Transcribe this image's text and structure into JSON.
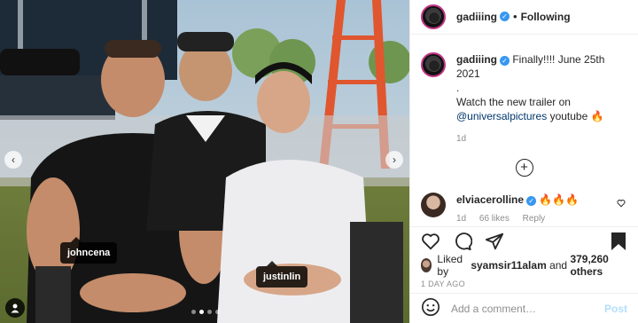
{
  "post": {
    "username": "gadiiing",
    "follow_label": "Following",
    "caption_username": "gadiiing",
    "caption_text": "Finally!!!! June 25th 2021",
    "caption_dot": ".",
    "caption_line2": "Watch the new trailer on",
    "caption_mention": "@universalpictures",
    "caption_suffix": "youtube 🔥",
    "caption_time": "1d",
    "photo_tags": [
      "johncena",
      "justinlin"
    ],
    "carousel": {
      "count": 4,
      "active": 2
    }
  },
  "reply": {
    "username": "elviacerolline",
    "text": "🔥🔥🔥",
    "time": "1d",
    "likes": "66 likes",
    "reply_label": "Reply"
  },
  "likes": {
    "prefix": "Liked by",
    "user": "syamsir11alam",
    "and": "and",
    "count": "379,260 others"
  },
  "timestamp": "1 DAY AGO",
  "comment_input": {
    "placeholder": "Add a comment…",
    "post_label": "Post"
  },
  "icons": [
    "heart-icon",
    "comment-icon",
    "share-icon",
    "bookmark-icon",
    "emoji-icon",
    "plus-icon",
    "chevron-left-icon",
    "chevron-right-icon",
    "verified-badge-icon",
    "person-tag-icon"
  ],
  "colors": {
    "verified": "#3897f0",
    "link": "#00376b",
    "post_disabled": "#b2dffc",
    "muted": "#8e8e8e"
  }
}
